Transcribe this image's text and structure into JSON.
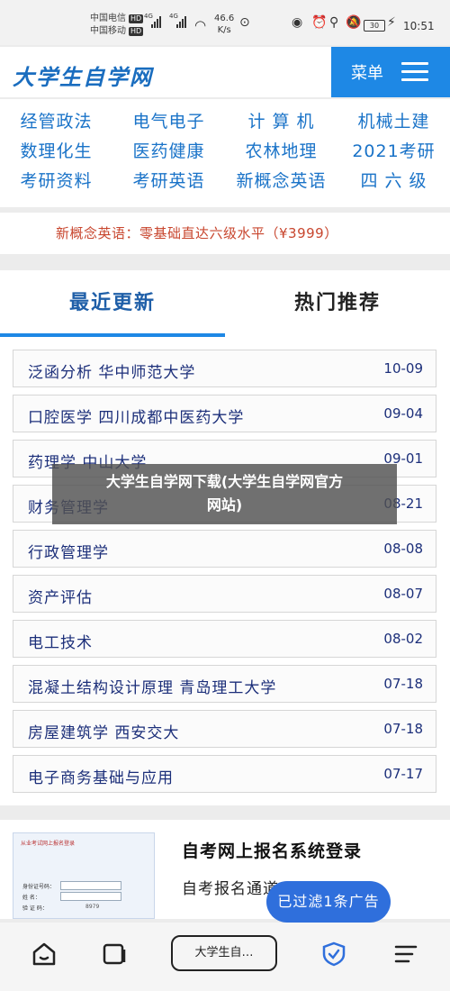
{
  "status_bar": {
    "carrier1": "中国电信",
    "carrier2": "中国移动",
    "hd": "HD",
    "net1": "4G",
    "net2": "4G",
    "speed_value": "46.6",
    "speed_unit": "K/s",
    "battery": "30",
    "time": "10:51"
  },
  "header": {
    "logo": "大学生自学网",
    "menu_label": "菜单"
  },
  "categories": [
    "经管政法",
    "电气电子",
    "计 算 机",
    "机械土建",
    "数理化生",
    "医药健康",
    "农林地理",
    "2021考研",
    "考研资料",
    "考研英语",
    "新概念英语",
    "四 六 级"
  ],
  "promo": "新概念英语：零基础直达六级水平（¥3999）",
  "tabs": {
    "recent": "最近更新",
    "hot": "热门推荐"
  },
  "list": [
    {
      "title": "泛函分析 华中师范大学",
      "date": "10-09"
    },
    {
      "title": "口腔医学 四川成都中医药大学",
      "date": "09-04"
    },
    {
      "title": "药理学 中山大学",
      "date": "09-01"
    },
    {
      "title": "财务管理学",
      "date": "08-21"
    },
    {
      "title": "行政管理学",
      "date": "08-08"
    },
    {
      "title": "资产评估",
      "date": "08-07"
    },
    {
      "title": "电工技术",
      "date": "08-02"
    },
    {
      "title": "混凝土结构设计原理 青岛理工大学",
      "date": "07-18"
    },
    {
      "title": "房屋建筑学 西安交大",
      "date": "07-18"
    },
    {
      "title": "电子商务基础与应用",
      "date": "07-17"
    }
  ],
  "overlay_caption": {
    "line1": "大学生自学网下载(大学生自学网官方",
    "line2": "网站)"
  },
  "article": {
    "title": "自考网上报名系统登录",
    "subtitle": "自考报名通道",
    "thumb_title": "从业考试网上报名登录",
    "thumb_label1": "身份证号码：",
    "thumb_label2": "姓    名：",
    "thumb_label3": "验 证 码：",
    "thumb_code": "8979"
  },
  "ad_filter": "已过滤1条广告",
  "bottom_nav": {
    "address": "大学生自…"
  },
  "colors": {
    "accent": "#1e88e5",
    "link": "#1a73c8",
    "promo": "#c8462e"
  }
}
